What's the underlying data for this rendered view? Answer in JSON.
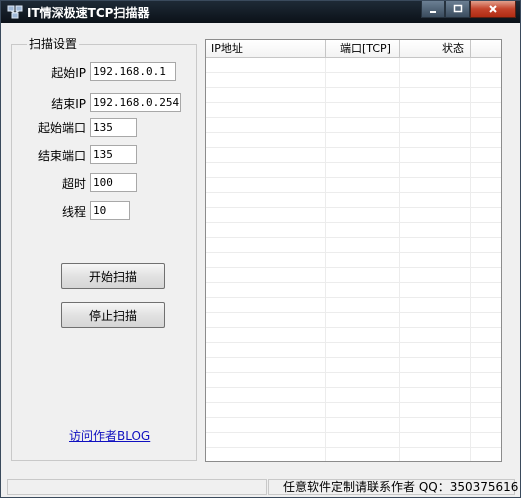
{
  "window": {
    "title": "IT情深极速TCP扫描器"
  },
  "scan_settings": {
    "group_title": "扫描设置",
    "fields": [
      {
        "label": "起始IP",
        "value": "192.168.0.1"
      },
      {
        "label": "结束IP",
        "value": "192.168.0.254"
      },
      {
        "label": "起始端口",
        "value": "135"
      },
      {
        "label": "结束端口",
        "value": "135"
      },
      {
        "label": "超时",
        "value": "100"
      },
      {
        "label": "线程",
        "value": "10"
      }
    ],
    "start_button": "开始扫描",
    "stop_button": "停止扫描",
    "blog_link": "访问作者BLOG"
  },
  "results": {
    "columns": [
      "IP地址",
      "端口[TCP]",
      "状态"
    ],
    "rows": []
  },
  "status_bar": {
    "message": "任意软件定制请联系作者 QQ：350375616"
  },
  "colors": {
    "titlebar": "#0b1118",
    "title_text": "#ffffff",
    "link": "#1010c0",
    "close_button": "#c4432b"
  },
  "icons": [
    "app-network-icon",
    "minimize-icon",
    "maximize-icon",
    "close-icon"
  ]
}
